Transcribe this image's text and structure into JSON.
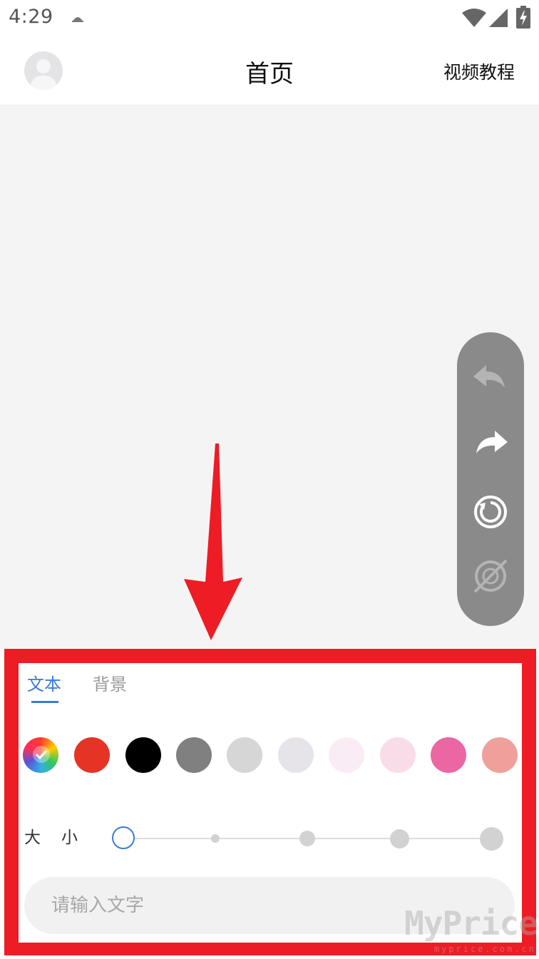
{
  "status_bar": {
    "time": "4:29"
  },
  "header": {
    "title": "首页",
    "video_tutorial_label": "视频教程"
  },
  "toolbar": {
    "undo_icon": "undo-icon",
    "redo_icon": "redo-icon",
    "reset_icon": "refresh-icon",
    "hide_icon": "hide-icon"
  },
  "panel": {
    "tabs": [
      {
        "label": "文本",
        "active": true
      },
      {
        "label": "背景",
        "active": false
      }
    ],
    "colors": [
      {
        "name": "color-wheel",
        "hex": "multicolor",
        "selected": true
      },
      {
        "name": "red",
        "hex": "#e53325"
      },
      {
        "name": "black",
        "hex": "#000000"
      },
      {
        "name": "gray",
        "hex": "#808080"
      },
      {
        "name": "light-gray",
        "hex": "#d6d6d6"
      },
      {
        "name": "pale-gray",
        "hex": "#e6e4e8"
      },
      {
        "name": "lavender-blush",
        "hex": "#faecf4"
      },
      {
        "name": "light-pink",
        "hex": "#f8dde8"
      },
      {
        "name": "hot-pink",
        "hex": "#ec66a4"
      },
      {
        "name": "salmon",
        "hex": "#f0a09a"
      }
    ],
    "size": {
      "label_big": "大",
      "label_small": "小",
      "selected_index": 0,
      "levels": 5
    },
    "input": {
      "placeholder": "请输入文字",
      "value": ""
    }
  },
  "colors": {
    "accent": "#3a7bd5",
    "highlight_frame": "#ee1c24",
    "tool_pill": "#8a8a8a"
  },
  "watermark": {
    "brand": "MyPrice",
    "domain": "myprice.com.cn"
  }
}
